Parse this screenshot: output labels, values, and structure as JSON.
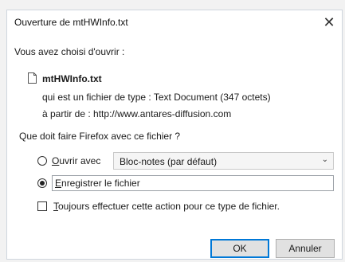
{
  "window": {
    "title": "Ouverture de mtHWInfo.txt",
    "close_glyph": "✕"
  },
  "body": {
    "intro": "Vous avez choisi d'ouvrir :",
    "file_icon": "file-icon",
    "file_name": "mtHWInfo.txt",
    "type_label": "qui est un fichier de type :",
    "type_value": "Text Document (347 octets)",
    "source_label": "à partir de :",
    "source_value": "http://www.antares-diffusion.com",
    "question": "Que doit faire Firefox avec ce fichier ?"
  },
  "options": {
    "open_with": {
      "label_first": "O",
      "label_rest": "uvrir avec",
      "checked": false,
      "app": "Bloc-notes (par défaut)"
    },
    "save": {
      "label_first": "E",
      "label_rest": "nregistrer le fichier",
      "checked": true
    },
    "always": {
      "label_first": "T",
      "label_rest": "oujours effectuer cette action pour ce type de fichier.",
      "checked": false
    }
  },
  "buttons": {
    "ok": "OK",
    "cancel": "Annuler"
  },
  "colors": {
    "accent": "#0078d7"
  }
}
